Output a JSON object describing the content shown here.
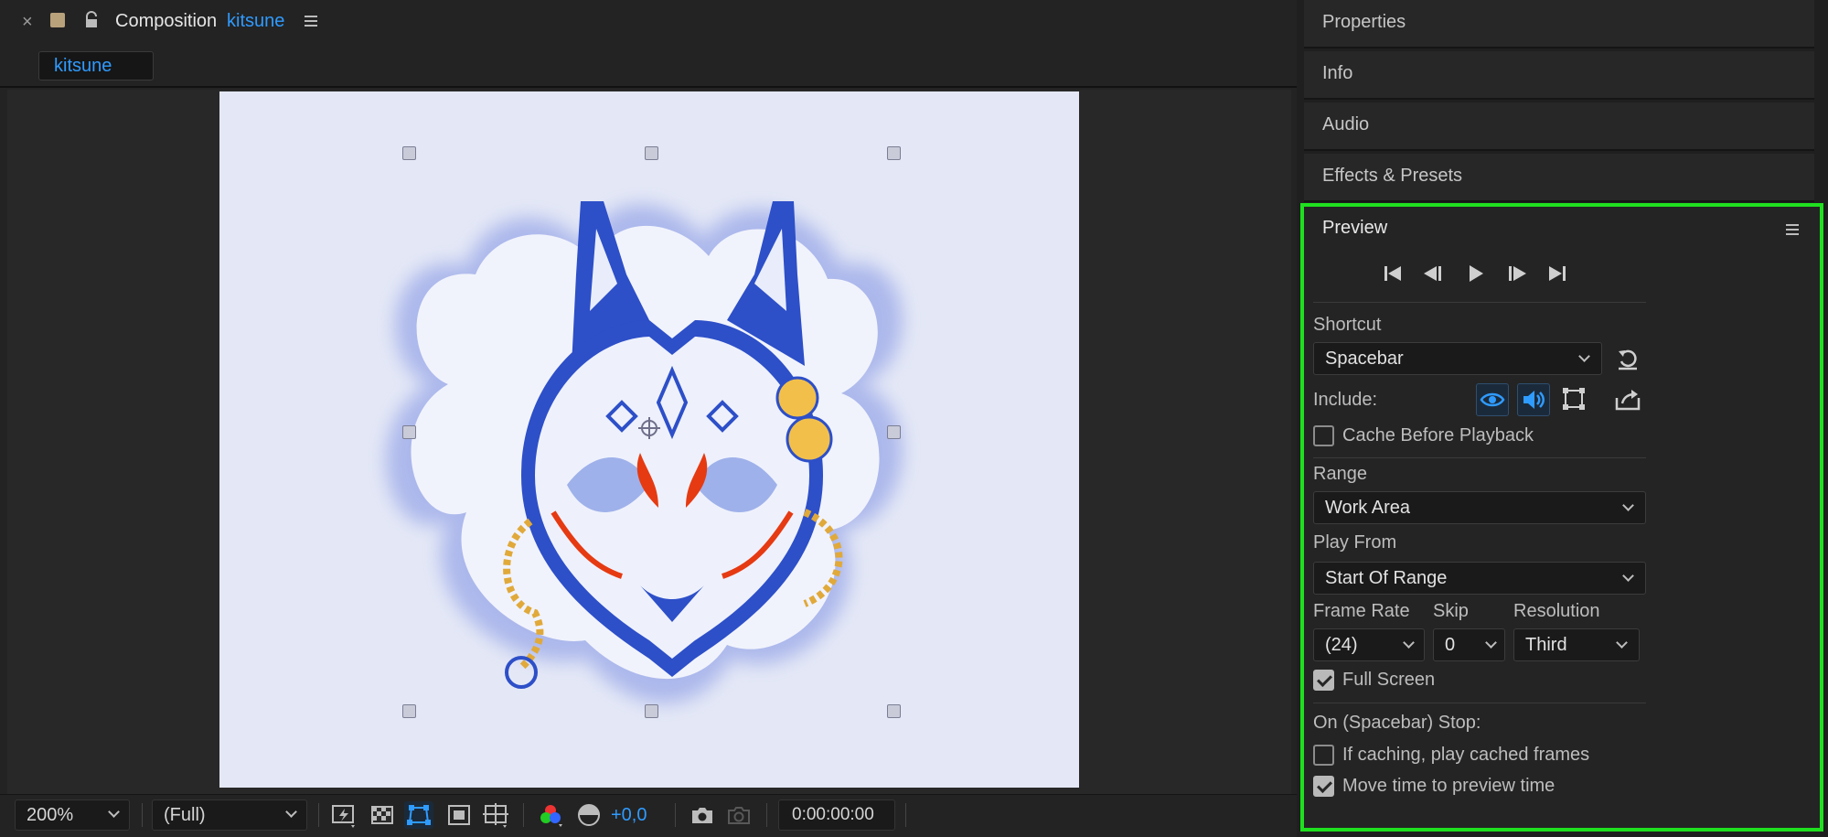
{
  "comp_panel": {
    "title": "Composition",
    "comp_name": "kitsune",
    "tab_label": "kitsune",
    "color_swatch": "#b8a27c"
  },
  "footer": {
    "zoom": "200%",
    "resolution": "(Full)",
    "exposure": "+0,0",
    "timecode": "0:00:00:00"
  },
  "panels": {
    "properties": "Properties",
    "info": "Info",
    "audio": "Audio",
    "effects": "Effects & Presets"
  },
  "preview": {
    "title": "Preview",
    "shortcut_label": "Shortcut",
    "shortcut_value": "Spacebar",
    "include_label": "Include:",
    "cache_label": "Cache Before Playback",
    "cache_checked": false,
    "range_label": "Range",
    "range_value": "Work Area",
    "play_from_label": "Play From",
    "play_from_value": "Start Of Range",
    "frame_rate_label": "Frame Rate",
    "frame_rate_value": "(24)",
    "skip_label": "Skip",
    "skip_value": "0",
    "resolution_label": "Resolution",
    "resolution_value": "Third",
    "full_screen_label": "Full Screen",
    "full_screen_checked": true,
    "on_stop_label": "On (Spacebar) Stop:",
    "if_caching_label": "If caching, play cached frames",
    "if_caching_checked": false,
    "move_time_label": "Move time to preview time",
    "move_time_checked": true
  },
  "colors": {
    "accent_blue": "#2f9bff",
    "highlight_green": "#1fe01f",
    "mask_blue": "#2d4fc8",
    "mask_red": "#e63a12",
    "bell_gold": "#f2c04a"
  }
}
